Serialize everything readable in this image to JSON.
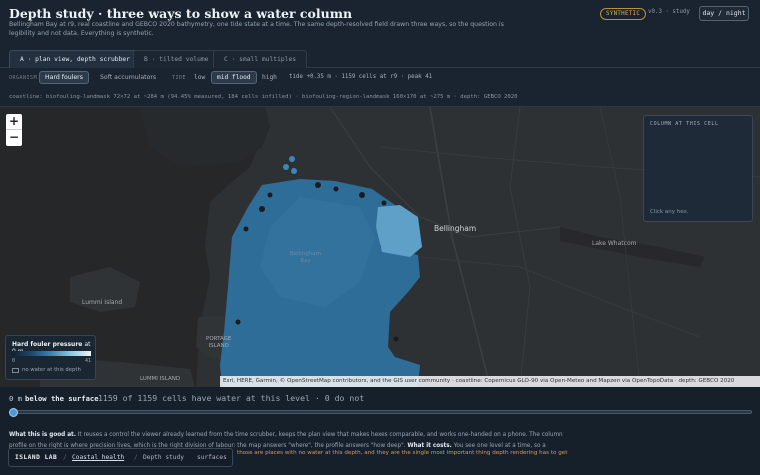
{
  "header": {
    "title": "Depth study · three ways to show a water column",
    "subtitle": "Bellingham Bay at r9, real coastline and GEBCO 2020 bathymetry, one tide state at a time. The same depth-resolved field drawn three ways, so the question is legibility and not data. Everything is synthetic.",
    "badge": "SYNTHETIC",
    "version": "v0.3 · study",
    "theme_button": "day / night"
  },
  "tabs": [
    {
      "label": "A · plan view, depth scrubber",
      "active": true
    },
    {
      "label": "B · tilted volume",
      "active": false
    },
    {
      "label": "C · small multiples",
      "active": false
    }
  ],
  "controls": {
    "organism_label": "ORGANISM",
    "organisms": [
      "Hard foulers",
      "Soft accumulators"
    ],
    "tide_label": "TIDE",
    "tides": [
      "low",
      "mid flood",
      "high"
    ],
    "info": "tide +0.35 m · 1159 cells at r9 · peak 41"
  },
  "coastline_text": "coastline: biofouling-landmask 72×72 at ~284 m (94.45% measured, 184 cells infilled) · biofouling-region-landmask 160×170 at ~275 m · depth: GEBCO 2020",
  "map": {
    "zoom_in": "+",
    "zoom_out": "−",
    "places": {
      "bellingham": "Bellingham",
      "lake_whatcom": "Lake Whatcom",
      "lummi_island": "Lummi Island",
      "portage_island": "PORTAGE\nISLAND",
      "lummi_island_lower": "LUMMI ISLAND",
      "bay": "Bellingham\nBay"
    },
    "column_panel": {
      "title": "COLUMN AT THIS CELL",
      "hint": "Click any hex."
    },
    "legend": {
      "title_prefix": "Hard fouler pressure",
      "title_suffix": "at 0 m",
      "min": "0",
      "max": "41",
      "no_water": "no water at this depth"
    },
    "attribution": "Esri, HERE, Garmin, © OpenStreetMap contributors, and the GIS user community · coastline: Copernicus GLO-90 via Open-Meteo and Mapzen via OpenTopoData · depth: GEBCO 2020"
  },
  "scrubber": {
    "depth_value": "0 m",
    "depth_label": "below the surface",
    "status": "1159 of 1159 cells have water at this level · 0 do not",
    "position_fraction": 0
  },
  "notes": {
    "good_label": "What this is good at.",
    "good_text": "It reuses a control the viewer already learned from the time scrubber, keeps the plan view that makes hexes comparable, and works one-handed on a phone. The column profile on the right is where precision lives, which is the right division of labour: the map answers \"where\", the profile answers \"how deep\".",
    "cost_label": "What it costs.",
    "cost_text": "You see one level at a time, so a difference between 2",
    "warning": "those are places with no water at this depth, and they are the single most important thing depth rendering has to get"
  },
  "navbar": {
    "brand": "ISLAND LAB",
    "items": [
      "Coastal health",
      "Depth study",
      "surfaces"
    ]
  },
  "colors": {
    "accent": "#4f97d8",
    "badge": "#d8b060",
    "water_deep": "#2d6f9c",
    "water_light": "#5a9fc8"
  }
}
